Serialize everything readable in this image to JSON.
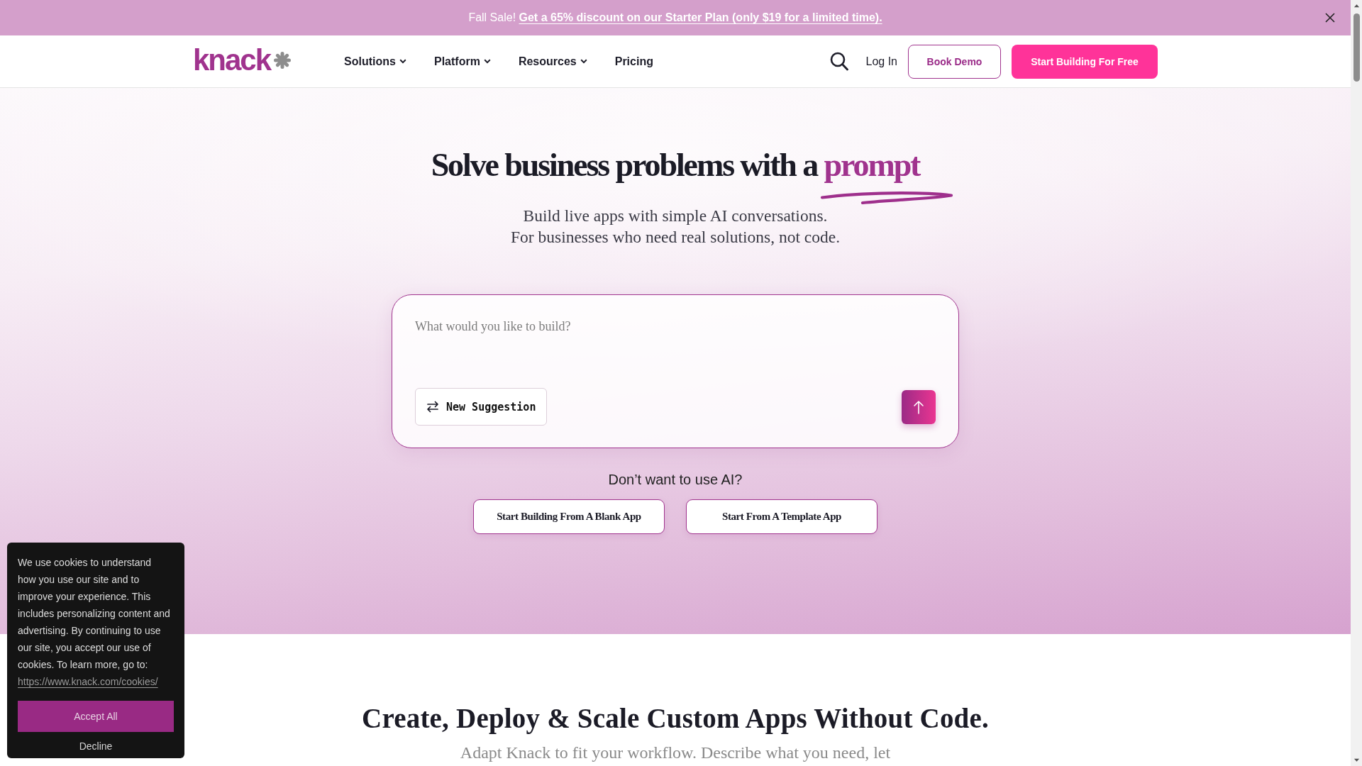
{
  "banner": {
    "lead": "Fall Sale!",
    "link": "Get a 65% discount on our Starter Plan (only $19 for a limited time)."
  },
  "nav": {
    "logo": "knack",
    "links": [
      {
        "label": "Solutions",
        "dropdown": true
      },
      {
        "label": "Platform",
        "dropdown": true
      },
      {
        "label": "Resources",
        "dropdown": true
      },
      {
        "label": "Pricing",
        "dropdown": false
      }
    ],
    "login": "Log In",
    "demo_button": "Book Demo",
    "cta_button": "Start Building For Free"
  },
  "hero": {
    "title": "Solve business problems with a",
    "highlight": "prompt",
    "subtitle": [
      "Build live apps with simple AI conversations.",
      "For businesses who need real solutions, not code."
    ],
    "prompt": {
      "placeholder": "What would you like to build?",
      "suggestion_button": "New Suggestion"
    },
    "alt_question": "Don’t want to use AI?",
    "alt_buttons": [
      "Start Building From A Blank App",
      "Start From A Template App"
    ]
  },
  "features": {
    "heading": "Create, Deploy & Scale Custom Apps Without Code.",
    "text": "Adapt Knack to fit your workflow. Describe what you need, let"
  },
  "cookie_notice": {
    "text": "We use cookies to understand how you use our site and to improve your experience. This includes personalizing content and advertising. By continuing to use our site, you accept our use of cookies. To learn more, go to:",
    "link": "https://www.knack.com/cookies/",
    "accept_button": "Accept All",
    "decline_button": "Decline"
  }
}
